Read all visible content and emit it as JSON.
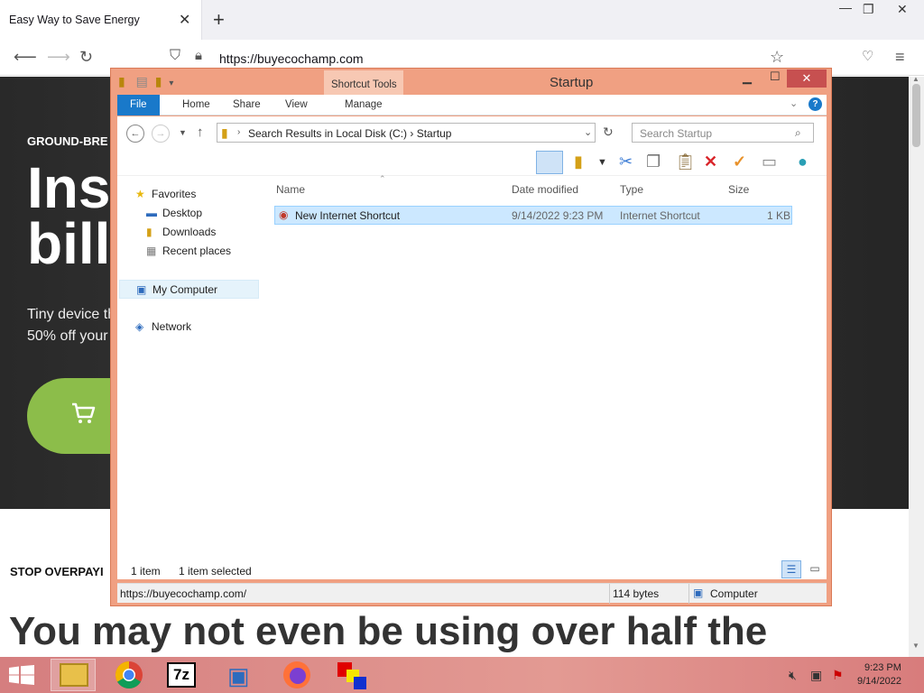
{
  "browser": {
    "tab_title": "Easy Way to Save Energy",
    "tab_close": "✕",
    "new_tab": "+",
    "url": "https://buyecochamp.com",
    "window_controls": {
      "minimize": "—",
      "restore": "❐",
      "close": "✕"
    }
  },
  "page": {
    "hero_eyebrow": "GROUND-BRE",
    "hero_title": "Ins bill",
    "hero_subtitle": "Tiny device th 50% off your",
    "stop_heading": "STOP OVERPAYI",
    "big_heading": "You may not even be using over half the",
    "cart_icon": "cart-icon"
  },
  "explorer": {
    "title": "Startup",
    "contextual_tab": "Shortcut Tools",
    "ribbon_tabs": [
      "File",
      "Home",
      "Share",
      "View",
      "Manage"
    ],
    "help": "?",
    "address_path": "Search Results in Local Disk (C:)  ›  Startup",
    "search_placeholder": "Search Startup",
    "nav": {
      "favorites": "Favorites",
      "desktop": "Desktop",
      "downloads": "Downloads",
      "recent": "Recent places",
      "computer": "My Computer",
      "network": "Network"
    },
    "columns": {
      "name": "Name",
      "date": "Date modified",
      "type": "Type",
      "size": "Size"
    },
    "files": [
      {
        "name": "New Internet Shortcut",
        "date": "9/14/2022 9:23 PM",
        "type": "Internet Shortcut",
        "size": "1 KB"
      }
    ],
    "status_items": "1 item",
    "status_selected": "1 item selected",
    "details_url": "https://buyecochamp.com/",
    "details_size": "114 bytes",
    "details_location": "Computer"
  },
  "taskbar": {
    "time": "9:23 PM",
    "date": "9/14/2022",
    "apps": [
      "file-explorer-icon",
      "chrome-icon",
      "7zip-icon",
      "network-tool-icon",
      "firefox-icon",
      "paint-icon"
    ],
    "sevenzip_label": "7z"
  },
  "colors": {
    "window_frame": "#f0a082",
    "file_tab": "#1979ca",
    "selection": "#cce8ff",
    "taskbar": "#d9787a",
    "cart_button": "#8cbd4a"
  }
}
